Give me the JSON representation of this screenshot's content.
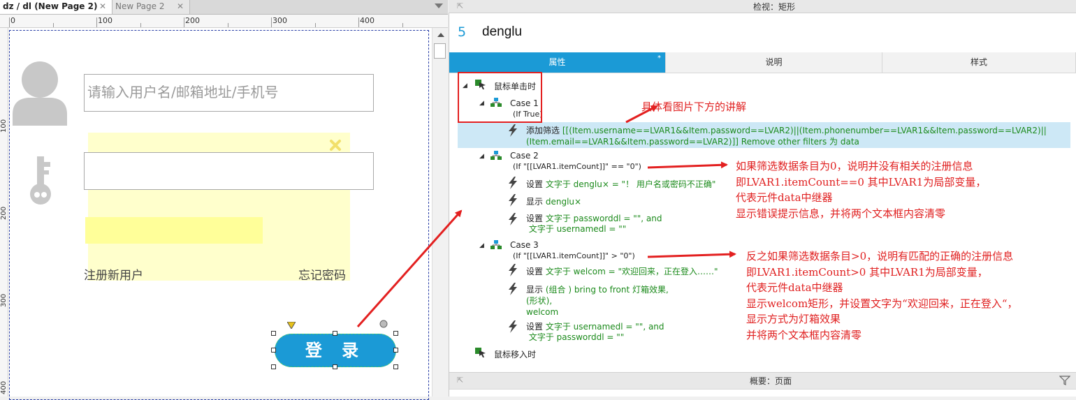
{
  "editor": {
    "tabs": [
      {
        "label": "dz / dl (New Page 2)",
        "close": "✕"
      },
      {
        "label": "New Page 2",
        "close": "✕"
      }
    ],
    "ruler_h": [
      "0",
      "100",
      "200",
      "300",
      "400"
    ],
    "ruler_v": [
      "100",
      "200",
      "300",
      "400"
    ],
    "username_placeholder": "请输入用户名/邮箱地址/手机号",
    "register_link": "注册新用户",
    "forgot_link": "忘记密码",
    "login_button": "登 录",
    "icons": [
      "user-avatar-icon",
      "key-icon",
      "close-x-icon"
    ]
  },
  "inspector": {
    "header": "检视：矩形",
    "widget_number": "5",
    "widget_name": "denglu",
    "tabs": [
      {
        "label": "属性",
        "active": true,
        "star": "*"
      },
      {
        "label": "说明"
      },
      {
        "label": "样式"
      }
    ],
    "events": [
      {
        "label": "鼠标单击时",
        "cases": [
          {
            "label": "Case 1",
            "condition": "(If True)",
            "actions": [
              {
                "verb": "添加筛选",
                "text": "[[(Item.username==LVAR1&&Item.password==LVAR2)||(Item.phonenumber==LVAR1&&Item.password==LVAR2)||",
                "text2": "(Item.email==LVAR1&&Item.password==LVAR2)]] Remove other filters 为 data"
              }
            ]
          },
          {
            "label": "Case 2",
            "condition": "(If \"[[LVAR1.itemCount]]\" == \"0\")",
            "actions": [
              {
                "verb": "设置",
                "text": "文字于 denglu× = \"！ 用户名或密码不正确\""
              },
              {
                "verb": "显示",
                "text": "denglu×"
              },
              {
                "verb": "设置",
                "text": "文字于 passworddl = \"\", and",
                "text2": "文字于 usernamedl = \"\""
              }
            ]
          },
          {
            "label": "Case 3",
            "condition": "(If \"[[LVAR1.itemCount]]\" > \"0\")",
            "actions": [
              {
                "verb": "设置",
                "text": "文字于 welcom = \"欢迎回来，正在登入……\""
              },
              {
                "verb": "显示",
                "text": "(组合 ) bring to front 灯箱效果,",
                "text2": "(形状),",
                "text3": "welcom"
              },
              {
                "verb": "设置",
                "text": "文字于 usernamedl = \"\", and",
                "text2": "文字于 passworddl = \"\""
              }
            ]
          }
        ]
      },
      {
        "label": "鼠标移入时"
      }
    ],
    "summary_header": "概要：页面"
  },
  "annotations": {
    "note1": "具体看图片下方的讲解",
    "note2": [
      "如果筛选数据条目为0，说明并没有相关的注册信息",
      "即LVAR1.itemCount==0  其中LVAR1为局部变量，",
      "代表元件data中继器",
      "显示错误提示信息，并将两个文本框内容清零"
    ],
    "note3": [
      "反之如果筛选数据条目>0，说明有匹配的正确的注册信息",
      "即LVAR1.itemCount>0  其中LVAR1为局部变量，",
      "代表元件data中继器",
      "显示welcom矩形，并设置文字为“欢迎回来，正在登入“，",
      "显示方式为灯箱效果",
      "并将两个文本框内容清零"
    ]
  },
  "colors": {
    "accent": "#1b9ad6",
    "annotation": "#e02020",
    "action_text": "#1b8a1b",
    "highlight": "#cde8f6"
  }
}
